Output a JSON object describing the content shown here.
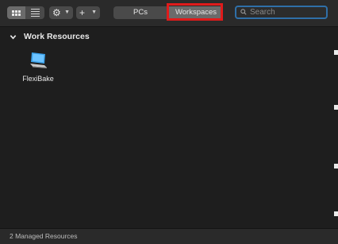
{
  "toolbar": {
    "view_icons": [
      "grid-view-icon",
      "list-view-icon"
    ],
    "action_menu_icon": "gear-icon",
    "add_menu_icon": "plus-icon",
    "tabs": [
      {
        "label": "PCs",
        "selected": false
      },
      {
        "label": "Workspaces",
        "selected": true
      }
    ],
    "highlight_color": "#e01b1b",
    "search": {
      "placeholder": "Search",
      "value": ""
    }
  },
  "section": {
    "title": "Work Resources",
    "expanded": true
  },
  "resources": [
    {
      "name": "FlexiBake",
      "icon": "pc-icon"
    }
  ],
  "footer": {
    "status": "2 Managed Resources"
  }
}
